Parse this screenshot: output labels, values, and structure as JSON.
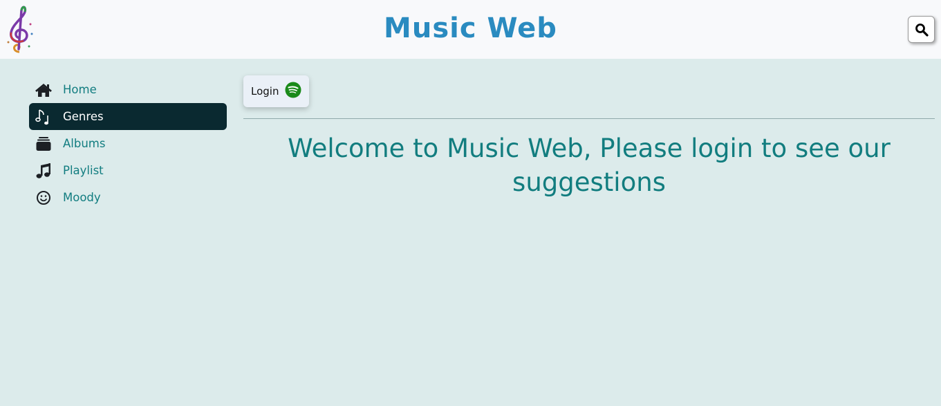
{
  "header": {
    "title": "Music Web",
    "logo_icon": "treble-clef-icon",
    "search_icon": "search-icon"
  },
  "sidebar": {
    "items": [
      {
        "label": "Home",
        "icon": "home-icon",
        "active": false
      },
      {
        "label": "Genres",
        "icon": "music-notes-icon",
        "active": true
      },
      {
        "label": "Albums",
        "icon": "albums-icon",
        "active": false
      },
      {
        "label": "Playlist",
        "icon": "music-note-icon",
        "active": false
      },
      {
        "label": "Moody",
        "icon": "smile-icon",
        "active": false
      }
    ]
  },
  "main": {
    "login_label": "Login",
    "login_icon": "spotify-icon",
    "welcome_text": "Welcome to Music Web, Please login to see our suggestions"
  },
  "colors": {
    "background": "#dcebeb",
    "header_bg": "#f8f9fb",
    "title": "#2a8bc0",
    "accent_text": "#127d80",
    "active_bg": "#0a2930",
    "spotify": "#1a8a1a"
  }
}
